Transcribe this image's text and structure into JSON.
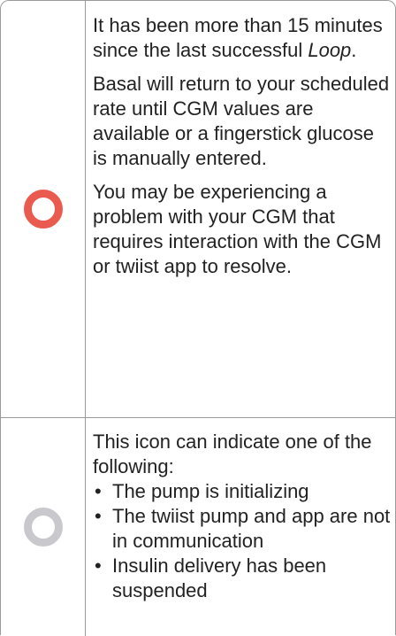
{
  "rows": [
    {
      "icon": {
        "name": "loop-ring-red-icon",
        "color": "#e95a4f"
      },
      "paragraphs": [
        {
          "before": "It has been more than 15 minutes since the last successful ",
          "emphasis": "Loop",
          "after": "."
        },
        {
          "text": "Basal will return to your scheduled rate until CGM values are available or a fingerstick glucose is manually entered."
        },
        {
          "text": "You may be experiencing a problem with your CGM that requires interaction with the CGM or twiist app to resolve."
        }
      ]
    },
    {
      "icon": {
        "name": "loop-ring-gray-icon",
        "color": "#c9c9cd"
      },
      "intro": "This icon can indicate one of the following:",
      "bullets": [
        "The pump is initializing",
        "The twiist pump and app are not in communication",
        "Insulin delivery has been suspended"
      ]
    }
  ]
}
